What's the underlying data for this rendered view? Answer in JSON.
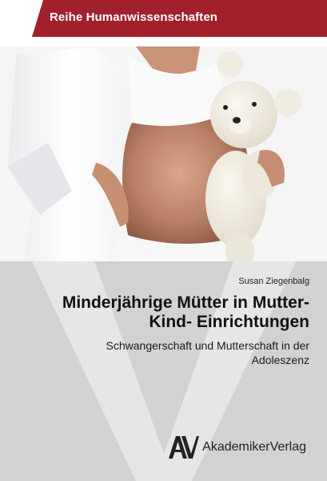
{
  "series": {
    "label": "Reihe Humanwissenschaften"
  },
  "cover_photo": {
    "description_icon": "pregnant-woman-with-teddy-bear-photo"
  },
  "author": "Susan Ziegenbalg",
  "title": "Minderjährige Mütter in Mutter-Kind- Einrichtungen",
  "subtitle": "Schwangerschaft und Mutterschaft in der Adoleszenz",
  "publisher": {
    "name": "AkademikerVerlag",
    "logo_icon": "av-logo-icon"
  },
  "colors": {
    "banner": "#a21f2c",
    "lower_background": "#d2d2d4",
    "watermark": "#ffffff"
  }
}
